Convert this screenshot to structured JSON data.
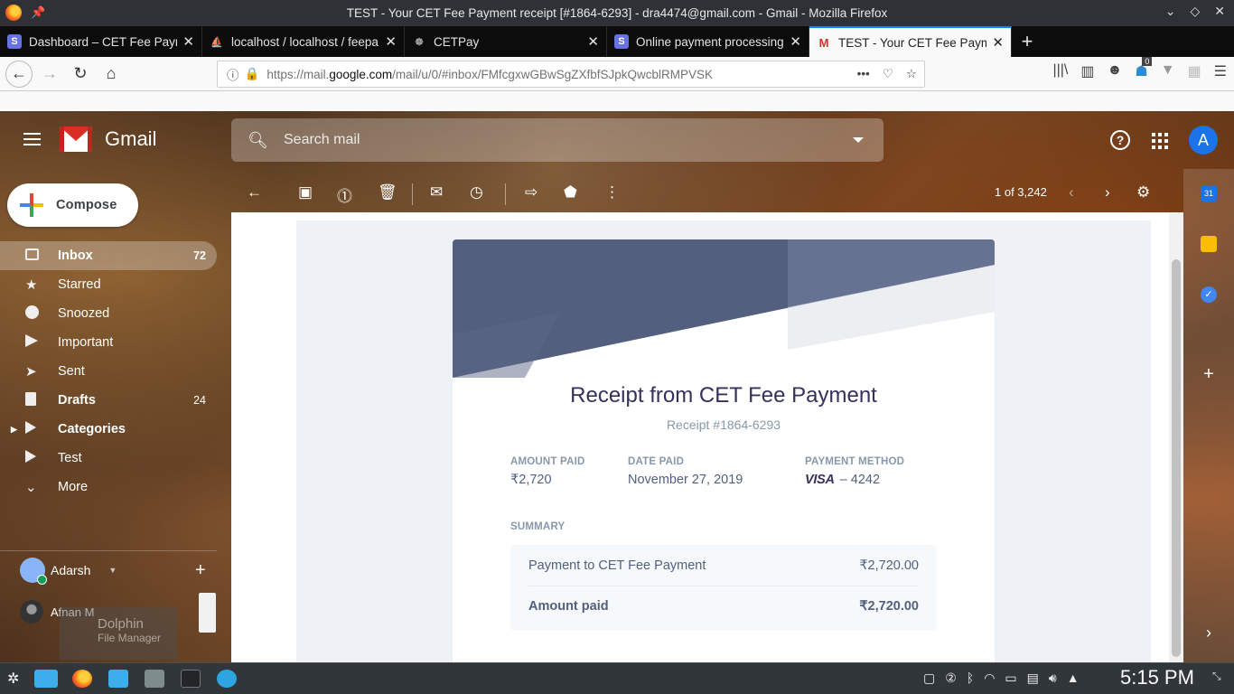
{
  "window": {
    "title": "TEST - Your CET Fee Payment receipt [#1864-6293] - dra4474@gmail.com - Gmail - Mozilla Firefox"
  },
  "tabs": [
    {
      "label": "Dashboard – CET Fee Paym",
      "favicon": "S",
      "color": "#6772e5"
    },
    {
      "label": "localhost / localhost / feepa",
      "favicon": "pma",
      "color": "#f29111"
    },
    {
      "label": "CETPay",
      "favicon": "cet",
      "color": "#999999"
    },
    {
      "label": "Online payment processing",
      "favicon": "S",
      "color": "#6772e5"
    },
    {
      "label": "TEST - Your CET Fee Payme",
      "favicon": "M",
      "color": "#d93025"
    }
  ],
  "navbar": {
    "url_prefix": "https://mail.",
    "url_host": "google.com",
    "url_suffix": "/mail/u/0/#inbox/FMfcgxwGBwSgZXfbfSJpkQwcblRMPVSK",
    "badge_count": "0"
  },
  "gmail": {
    "product_name": "Gmail",
    "search_placeholder": "Search mail",
    "avatar_letter": "A",
    "compose_label": "Compose",
    "nav": [
      {
        "label": "Inbox",
        "count": "72",
        "icon": "inbox-icon",
        "active": true,
        "bold": true
      },
      {
        "label": "Starred",
        "count": "",
        "icon": "star-icon"
      },
      {
        "label": "Snoozed",
        "count": "",
        "icon": "clock-icon"
      },
      {
        "label": "Important",
        "count": "",
        "icon": "important-icon"
      },
      {
        "label": "Sent",
        "count": "",
        "icon": "send-icon"
      },
      {
        "label": "Drafts",
        "count": "24",
        "icon": "draft-icon",
        "bold": true
      },
      {
        "label": "Categories",
        "count": "",
        "icon": "label-icon",
        "bold": true
      },
      {
        "label": "Test",
        "count": "",
        "icon": "label-icon"
      },
      {
        "label": "More",
        "count": "",
        "icon": "chevron-down-icon"
      }
    ],
    "hangouts_user": "Adarsh",
    "contact_name": "Afnan M",
    "pager": "1 of 3,242"
  },
  "receipt": {
    "title": "Receipt from CET Fee Payment",
    "number": "Receipt #1864-6293",
    "amount_paid_label": "AMOUNT PAID",
    "amount_paid_value": "₹2,720",
    "date_paid_label": "DATE PAID",
    "date_paid_value": "November 27, 2019",
    "method_label": "PAYMENT METHOD",
    "method_brand": "VISA",
    "method_last4": "– 4242",
    "summary_label": "SUMMARY",
    "summary_rows": [
      {
        "label": "Payment to CET Fee Payment",
        "amount": "₹2,720.00"
      },
      {
        "label": "Amount paid",
        "amount": "₹2,720.00"
      }
    ]
  },
  "taskbar": {
    "clock": "5:15 PM",
    "tooltip_title": "Dolphin",
    "tooltip_sub": "File Manager"
  },
  "colors": {
    "accent": "#0a84ff",
    "gmail_red": "#d93025",
    "receipt_header": "#525f7f"
  }
}
